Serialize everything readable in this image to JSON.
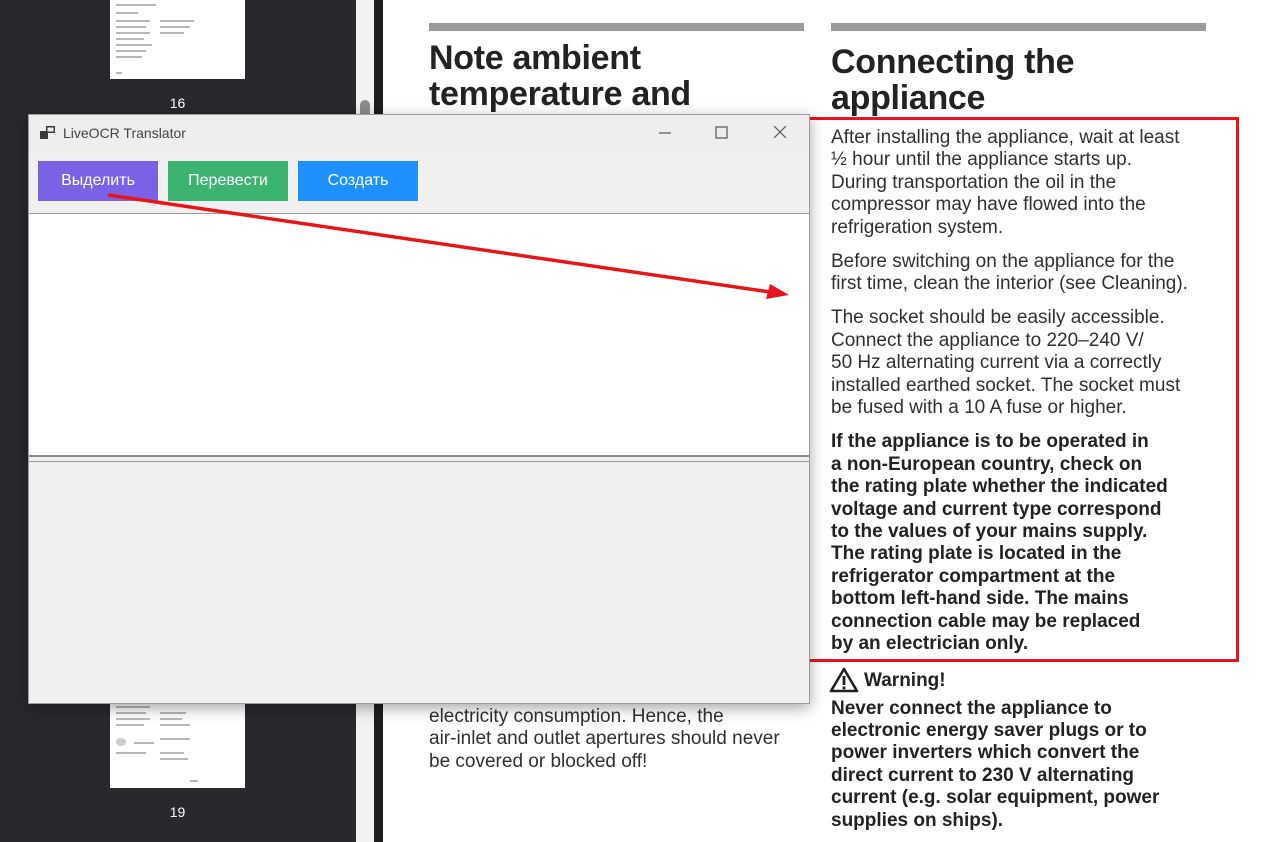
{
  "thumbnails": {
    "page_16": "16",
    "page_19": "19"
  },
  "document": {
    "left_heading_line1": "Note ambient",
    "left_heading_line2": "temperature and",
    "left_body_line1": "electricity consumption. Hence, the",
    "left_body_line2": "air-inlet and outlet apertures should never",
    "left_body_line3": "be covered or blocked off!",
    "right_heading_line1": "Connecting the",
    "right_heading_line2": "appliance",
    "para1": [
      "After installing the appliance, wait at least",
      "½ hour until the appliance starts up.",
      "During transportation the oil in the",
      "compressor may have flowed into the",
      "refrigeration system."
    ],
    "para2": [
      "Before switching on the appliance for the",
      "first time, clean the interior (see Cleaning)."
    ],
    "para3": [
      "The socket should be easily accessible.",
      "Connect the appliance to 220–240 V/",
      "50 Hz alternating current via a correctly",
      "installed earthed socket. The socket must",
      "be fused with a 10 A fuse or higher."
    ],
    "para4_bold": [
      "If the appliance is to be operated in",
      "a non-European country, check on",
      "the rating plate whether the indicated",
      "voltage and current type correspond",
      "to the values of your mains supply.",
      "The rating plate is located in the",
      "refrigerator compartment at the",
      "bottom left-hand side. The mains",
      "connection cable may be replaced",
      "by an electrician only."
    ],
    "warning_label": "Warning!",
    "warning_text": [
      "Never connect the appliance to",
      "electronic energy saver plugs or to",
      "power inverters which convert the",
      "direct current to 230 V alternating",
      "current (e.g. solar equipment, power",
      "supplies on ships)."
    ]
  },
  "window": {
    "title": "LiveOCR Translator",
    "buttons": {
      "select": "Выделить",
      "translate": "Перевести",
      "create": "Создать"
    },
    "input_text": "",
    "output_text": ""
  },
  "colors": {
    "select_button": "#7b61e6",
    "translate_button": "#3cb371",
    "create_button": "#1e90ff",
    "annotation_red": "#e8141a"
  },
  "icons": [
    "app-icon",
    "minimize-icon",
    "maximize-icon",
    "close-icon",
    "warning-triangle-icon"
  ]
}
